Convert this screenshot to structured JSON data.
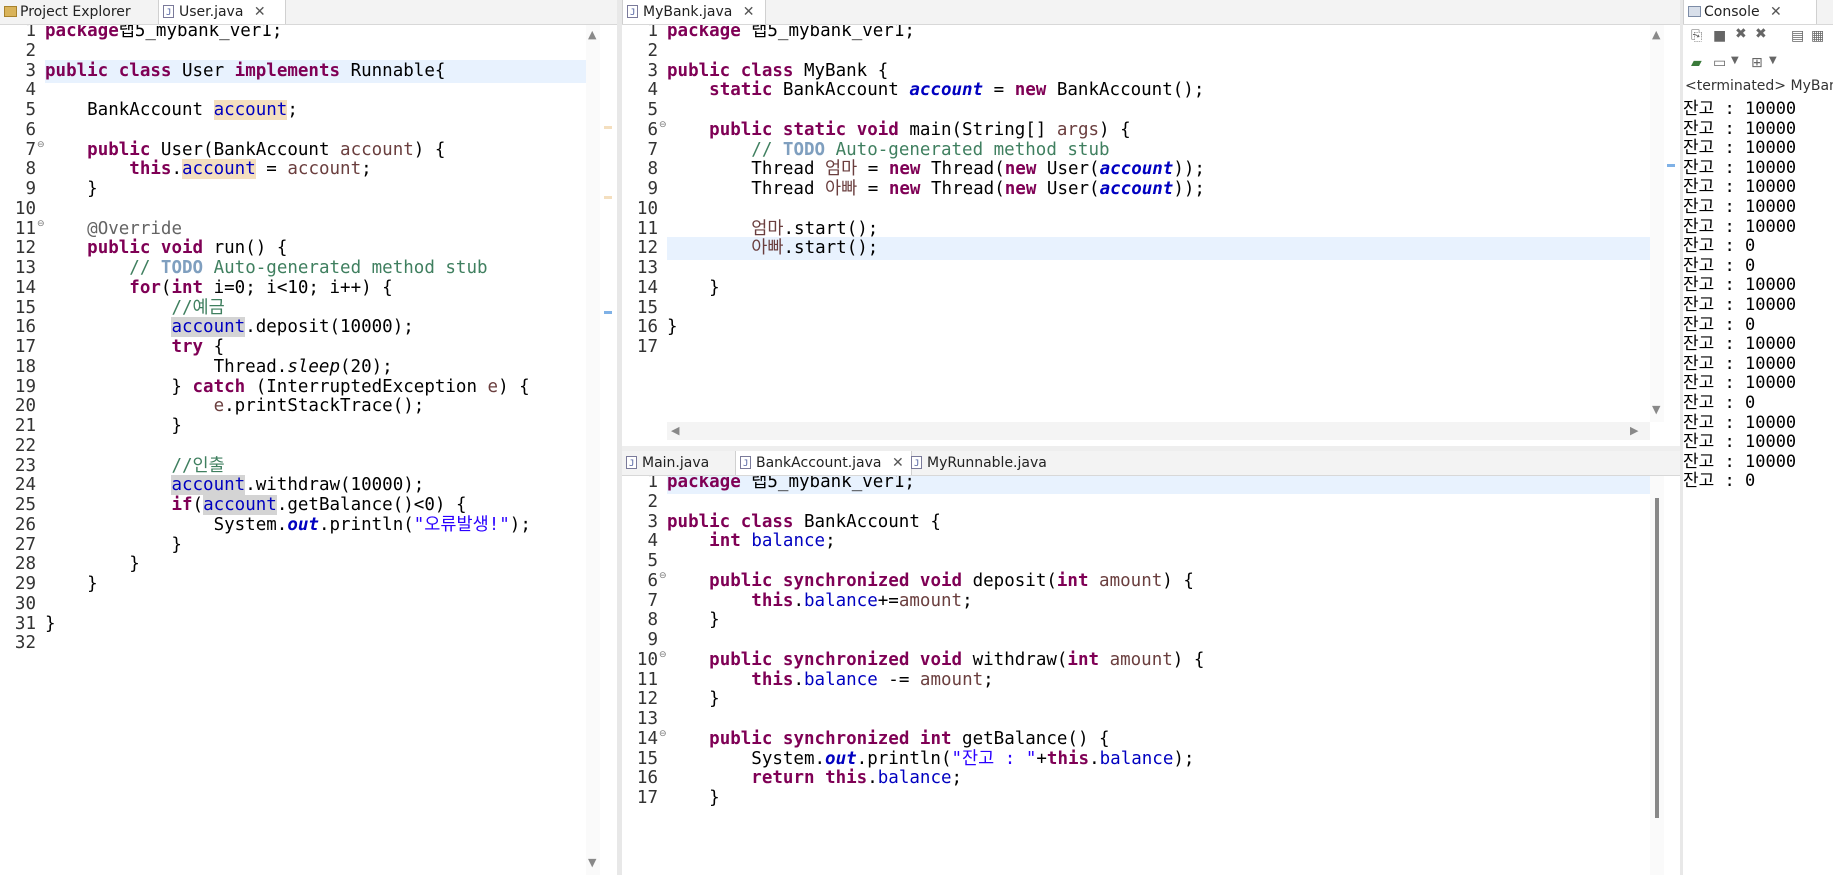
{
  "left_tabs": [
    {
      "label": "Project Explorer"
    },
    {
      "label": "User.java"
    }
  ],
  "mid_top_tabs": [
    {
      "label": "MyBank.java"
    }
  ],
  "mid_bottom_tabs": [
    {
      "label": "Main.java"
    },
    {
      "label": "BankAccount.java"
    },
    {
      "label": "MyRunnable.java"
    }
  ],
  "right_tabs": [
    {
      "label": "Console"
    }
  ],
  "close_glyph": "✕",
  "console": {
    "status": "<terminated> MyBan",
    "lines": [
      "잔고 : 10000",
      "잔고 : 10000",
      "잔고 : 10000",
      "잔고 : 10000",
      "잔고 : 10000",
      "잔고 : 10000",
      "잔고 : 10000",
      "잔고 : 0",
      "잔고 : 0",
      "잔고 : 10000",
      "잔고 : 10000",
      "잔고 : 0",
      "잔고 : 10000",
      "잔고 : 10000",
      "잔고 : 10000",
      "잔고 : 0",
      "잔고 : 10000",
      "잔고 : 10000",
      "잔고 : 10000",
      "잔고 : 0"
    ]
  },
  "user_java": {
    "line_numbers": [
      "1",
      "2",
      "3",
      "4",
      "5",
      "6",
      "7",
      "8",
      "9",
      "10",
      "11",
      "12",
      "13",
      "14",
      "15",
      "16",
      "17",
      "18",
      "19",
      "20",
      "21",
      "22",
      "23",
      "24",
      "25",
      "26",
      "27",
      "28",
      "29",
      "30",
      "31",
      "32"
    ],
    "lines": [
      [
        [
          "kw",
          "package"
        ],
        [
          "",
          "랩5_mybank_ver1;"
        ]
      ],
      [],
      [
        [
          "kw",
          "public"
        ],
        [
          "",
          " "
        ],
        [
          "kw",
          "class"
        ],
        [
          "",
          " User "
        ],
        [
          "kw",
          "implements"
        ],
        [
          "",
          " Runnable{"
        ]
      ],
      [],
      [
        [
          "",
          "    BankAccount "
        ],
        [
          "fd occ",
          "account"
        ],
        [
          "",
          ";"
        ]
      ],
      [],
      [
        [
          "",
          "    "
        ],
        [
          "kw",
          "public"
        ],
        [
          "",
          " User(BankAccount "
        ],
        [
          "vr",
          "account"
        ],
        [
          "",
          ") {"
        ]
      ],
      [
        [
          "",
          "        "
        ],
        [
          "kw",
          "this"
        ],
        [
          "",
          "."
        ],
        [
          "fd occ",
          "account"
        ],
        [
          "",
          " = "
        ],
        [
          "vr",
          "account"
        ],
        [
          "",
          ";"
        ]
      ],
      [
        [
          "",
          "    }"
        ]
      ],
      [],
      [
        [
          "",
          "    "
        ],
        [
          "an",
          "@Override"
        ]
      ],
      [
        [
          "",
          "    "
        ],
        [
          "kw",
          "public"
        ],
        [
          "",
          " "
        ],
        [
          "kw",
          "void"
        ],
        [
          "",
          " run() {"
        ]
      ],
      [
        [
          "",
          "        "
        ],
        [
          "cm",
          "// "
        ],
        [
          "todo",
          "TODO"
        ],
        [
          "cm",
          " Auto-generated method stub"
        ]
      ],
      [
        [
          "",
          "        "
        ],
        [
          "kw",
          "for"
        ],
        [
          "",
          "("
        ],
        [
          "kw",
          "int"
        ],
        [
          "",
          " i=0; i<10; i++) {"
        ]
      ],
      [
        [
          "",
          "            "
        ],
        [
          "cm",
          "//예금"
        ]
      ],
      [
        [
          "",
          "            "
        ],
        [
          "fd occ2",
          "account"
        ],
        [
          "",
          ".deposit(10000);"
        ]
      ],
      [
        [
          "",
          "            "
        ],
        [
          "kw",
          "try"
        ],
        [
          "",
          " {"
        ]
      ],
      [
        [
          "",
          "                Thread."
        ],
        [
          "sm",
          "sleep"
        ],
        [
          "",
          "(20);"
        ]
      ],
      [
        [
          "",
          "            } "
        ],
        [
          "kw",
          "catch"
        ],
        [
          "",
          " (InterruptedException "
        ],
        [
          "vr",
          "e"
        ],
        [
          "",
          ") {"
        ]
      ],
      [
        [
          "",
          "                "
        ],
        [
          "vr",
          "e"
        ],
        [
          "",
          ".printStackTrace();"
        ]
      ],
      [
        [
          "",
          "            }"
        ]
      ],
      [],
      [
        [
          "",
          "            "
        ],
        [
          "cm",
          "//인출"
        ]
      ],
      [
        [
          "",
          "            "
        ],
        [
          "fd occ2",
          "account"
        ],
        [
          "",
          ".withdraw(10000);"
        ]
      ],
      [
        [
          "",
          "            "
        ],
        [
          "kw",
          "if"
        ],
        [
          "",
          "("
        ],
        [
          "fd occ2",
          "account"
        ],
        [
          "",
          ".getBalance()<0) {"
        ]
      ],
      [
        [
          "",
          "                System."
        ],
        [
          "sf",
          "out"
        ],
        [
          "",
          ".println("
        ],
        [
          "st",
          "\"오류발생!\""
        ],
        [
          "",
          ");"
        ]
      ],
      [
        [
          "",
          "            }"
        ]
      ],
      [
        [
          "",
          "        }"
        ]
      ],
      [
        [
          "",
          "    }"
        ]
      ],
      [],
      [
        [
          "",
          "}"
        ]
      ],
      []
    ]
  },
  "mybank_java": {
    "line_numbers": [
      "1",
      "2",
      "3",
      "4",
      "5",
      "6",
      "7",
      "8",
      "9",
      "10",
      "11",
      "12",
      "13",
      "14",
      "15",
      "16",
      "17"
    ],
    "lines": [
      [
        [
          "kw",
          "package"
        ],
        [
          "",
          " 랩5_mybank_ver1;"
        ]
      ],
      [],
      [
        [
          "kw",
          "public"
        ],
        [
          "",
          " "
        ],
        [
          "kw",
          "class"
        ],
        [
          "",
          " MyBank {"
        ]
      ],
      [
        [
          "",
          "    "
        ],
        [
          "kw",
          "static"
        ],
        [
          "",
          " BankAccount "
        ],
        [
          "sf",
          "account"
        ],
        [
          "",
          " = "
        ],
        [
          "kw",
          "new"
        ],
        [
          "",
          " BankAccount();"
        ]
      ],
      [],
      [
        [
          "",
          "    "
        ],
        [
          "kw",
          "public"
        ],
        [
          "",
          " "
        ],
        [
          "kw",
          "static"
        ],
        [
          "",
          " "
        ],
        [
          "kw",
          "void"
        ],
        [
          "",
          " main(String[] "
        ],
        [
          "vr",
          "args"
        ],
        [
          "",
          ") {"
        ]
      ],
      [
        [
          "",
          "        "
        ],
        [
          "cm",
          "// "
        ],
        [
          "todo",
          "TODO"
        ],
        [
          "cm",
          " Auto-generated method stub"
        ]
      ],
      [
        [
          "",
          "        Thread "
        ],
        [
          "vr",
          "엄마"
        ],
        [
          "",
          " = "
        ],
        [
          "kw",
          "new"
        ],
        [
          "",
          " Thread("
        ],
        [
          "kw",
          "new"
        ],
        [
          "",
          " User("
        ],
        [
          "sf",
          "account"
        ],
        [
          "",
          "));"
        ]
      ],
      [
        [
          "",
          "        Thread "
        ],
        [
          "vr",
          "아빠"
        ],
        [
          "",
          " = "
        ],
        [
          "kw",
          "new"
        ],
        [
          "",
          " Thread("
        ],
        [
          "kw",
          "new"
        ],
        [
          "",
          " User("
        ],
        [
          "sf",
          "account"
        ],
        [
          "",
          "));"
        ]
      ],
      [],
      [
        [
          "",
          "        "
        ],
        [
          "vr",
          "엄마"
        ],
        [
          "",
          ".start();"
        ]
      ],
      [
        [
          "",
          "        "
        ],
        [
          "vr",
          "아빠"
        ],
        [
          "",
          ".start();"
        ]
      ],
      [],
      [
        [
          "",
          "    }"
        ]
      ],
      [],
      [
        [
          "",
          "}"
        ]
      ],
      []
    ]
  },
  "bankaccount_java": {
    "line_numbers": [
      "1",
      "2",
      "3",
      "4",
      "5",
      "6",
      "7",
      "8",
      "9",
      "10",
      "11",
      "12",
      "13",
      "14",
      "15",
      "16",
      "17"
    ],
    "lines": [
      [
        [
          "kw",
          "package"
        ],
        [
          "",
          " 랩5_mybank_ver1;"
        ]
      ],
      [],
      [
        [
          "kw",
          "public"
        ],
        [
          "",
          " "
        ],
        [
          "kw",
          "class"
        ],
        [
          "",
          " BankAccount {"
        ]
      ],
      [
        [
          "",
          "    "
        ],
        [
          "kw",
          "int"
        ],
        [
          "",
          " "
        ],
        [
          "fd",
          "balance"
        ],
        [
          "",
          ";"
        ]
      ],
      [],
      [
        [
          "",
          "    "
        ],
        [
          "kw",
          "public"
        ],
        [
          "",
          " "
        ],
        [
          "kw",
          "synchronized"
        ],
        [
          "",
          " "
        ],
        [
          "kw",
          "void"
        ],
        [
          "",
          " deposit("
        ],
        [
          "kw",
          "int"
        ],
        [
          "",
          " "
        ],
        [
          "vr",
          "amount"
        ],
        [
          "",
          ") {"
        ]
      ],
      [
        [
          "",
          "        "
        ],
        [
          "kw",
          "this"
        ],
        [
          "",
          "."
        ],
        [
          "fd",
          "balance"
        ],
        [
          "",
          "+="
        ],
        [
          "vr",
          "amount"
        ],
        [
          "",
          ";"
        ]
      ],
      [
        [
          "",
          "    }"
        ]
      ],
      [],
      [
        [
          "",
          "    "
        ],
        [
          "kw",
          "public"
        ],
        [
          "",
          " "
        ],
        [
          "kw",
          "synchronized"
        ],
        [
          "",
          " "
        ],
        [
          "kw",
          "void"
        ],
        [
          "",
          " withdraw("
        ],
        [
          "kw",
          "int"
        ],
        [
          "",
          " "
        ],
        [
          "vr",
          "amount"
        ],
        [
          "",
          ") {"
        ]
      ],
      [
        [
          "",
          "        "
        ],
        [
          "kw",
          "this"
        ],
        [
          "",
          "."
        ],
        [
          "fd",
          "balance"
        ],
        [
          "",
          " -= "
        ],
        [
          "vr",
          "amount"
        ],
        [
          "",
          ";"
        ]
      ],
      [
        [
          "",
          "    }"
        ]
      ],
      [],
      [
        [
          "",
          "    "
        ],
        [
          "kw",
          "public"
        ],
        [
          "",
          " "
        ],
        [
          "kw",
          "synchronized"
        ],
        [
          "",
          " "
        ],
        [
          "kw",
          "int"
        ],
        [
          "",
          " getBalance() {"
        ]
      ],
      [
        [
          "",
          "        System."
        ],
        [
          "sf",
          "out"
        ],
        [
          "",
          ".println("
        ],
        [
          "st",
          "\"잔고 : \""
        ],
        [
          "",
          "+"
        ],
        [
          "kw",
          "this"
        ],
        [
          "",
          "."
        ],
        [
          "fd",
          "balance"
        ],
        [
          "",
          ");"
        ]
      ],
      [
        [
          "",
          "        "
        ],
        [
          "kw",
          "return"
        ],
        [
          "",
          " "
        ],
        [
          "kw",
          "this"
        ],
        [
          "",
          "."
        ],
        [
          "fd",
          "balance"
        ],
        [
          "",
          ";"
        ]
      ],
      [
        [
          "",
          "    }"
        ]
      ]
    ]
  }
}
